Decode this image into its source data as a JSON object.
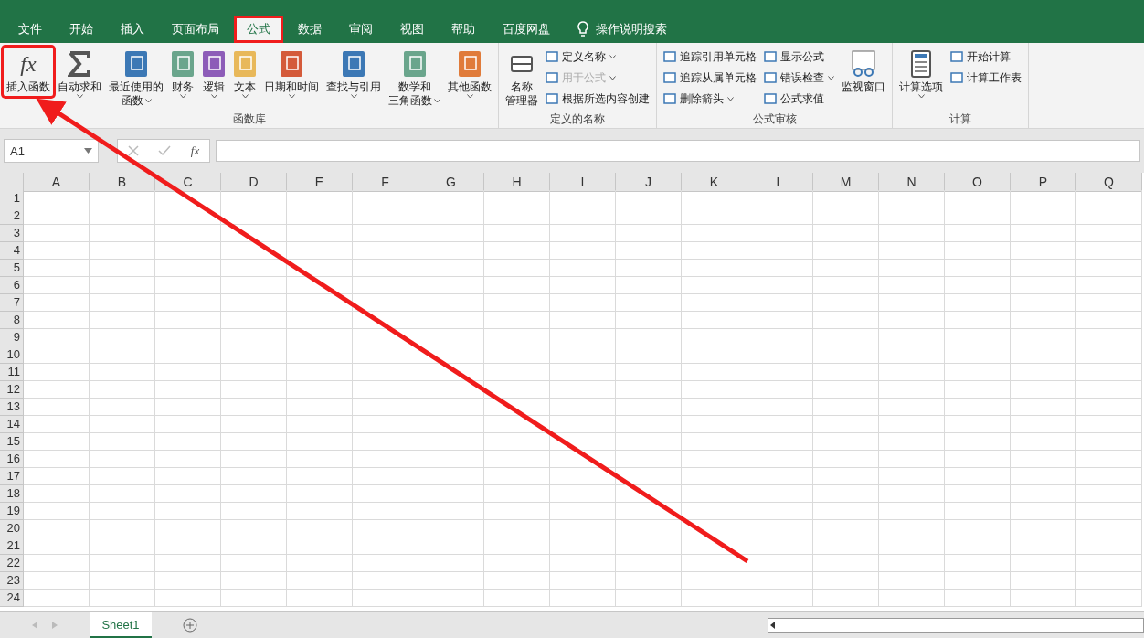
{
  "tabs": [
    {
      "label": "文件",
      "selected": false,
      "highlighted": false
    },
    {
      "label": "开始",
      "selected": false,
      "highlighted": false
    },
    {
      "label": "插入",
      "selected": false,
      "highlighted": false
    },
    {
      "label": "页面布局",
      "selected": false,
      "highlighted": false
    },
    {
      "label": "公式",
      "selected": true,
      "highlighted": true
    },
    {
      "label": "数据",
      "selected": false,
      "highlighted": false
    },
    {
      "label": "审阅",
      "selected": false,
      "highlighted": false
    },
    {
      "label": "视图",
      "selected": false,
      "highlighted": false
    },
    {
      "label": "帮助",
      "selected": false,
      "highlighted": false
    },
    {
      "label": "百度网盘",
      "selected": false,
      "highlighted": false
    }
  ],
  "tell_me": "操作说明搜索",
  "ribbon": [
    {
      "label": "函数库",
      "items": [
        {
          "kind": "fx",
          "symbol": "fx",
          "lines": [
            "插入函数"
          ],
          "dropdown": false,
          "highlighted": true
        },
        {
          "kind": "sigma",
          "lines": [
            "自动求和"
          ],
          "dropdown": true,
          "highlighted": false
        },
        {
          "kind": "book",
          "color": "#3c78b5",
          "lines": [
            "最近使用的",
            "函数"
          ],
          "dropdown": true,
          "highlighted": false
        },
        {
          "kind": "book",
          "color": "#6aa58c",
          "lines": [
            "财务"
          ],
          "dropdown": true,
          "highlighted": false
        },
        {
          "kind": "book",
          "color": "#8d5cb8",
          "lines": [
            "逻辑"
          ],
          "dropdown": true,
          "highlighted": false
        },
        {
          "kind": "book",
          "color": "#e8b85a",
          "lines": [
            "文本"
          ],
          "dropdown": true,
          "highlighted": false
        },
        {
          "kind": "book",
          "color": "#d45a3a",
          "lines": [
            "日期和时间"
          ],
          "dropdown": true,
          "highlighted": false
        },
        {
          "kind": "book",
          "color": "#3c78b5",
          "lines": [
            "查找与引用"
          ],
          "dropdown": true,
          "highlighted": false
        },
        {
          "kind": "book",
          "color": "#6aa58c",
          "lines": [
            "数学和",
            "三角函数"
          ],
          "dropdown": true,
          "highlighted": false
        },
        {
          "kind": "book",
          "color": "#e07b3a",
          "lines": [
            "其他函数"
          ],
          "dropdown": true,
          "highlighted": false
        }
      ]
    },
    {
      "label": "定义的名称",
      "items": [
        {
          "kind": "names",
          "lines": [
            "名称",
            "管理器"
          ],
          "dropdown": false,
          "highlighted": false
        },
        {
          "kind": "stack",
          "entries": [
            {
              "label": "定义名称",
              "dropdown": true,
              "disabled": false
            },
            {
              "label": "用于公式",
              "dropdown": true,
              "disabled": true
            },
            {
              "label": "根据所选内容创建",
              "dropdown": false,
              "disabled": false
            }
          ]
        }
      ]
    },
    {
      "label": "公式审核",
      "items": [
        {
          "kind": "stack",
          "entries": [
            {
              "label": "追踪引用单元格",
              "dropdown": false,
              "disabled": false
            },
            {
              "label": "追踪从属单元格",
              "dropdown": false,
              "disabled": false
            },
            {
              "label": "删除箭头",
              "dropdown": true,
              "disabled": false
            }
          ]
        },
        {
          "kind": "stack",
          "entries": [
            {
              "label": "显示公式",
              "dropdown": false,
              "disabled": false
            },
            {
              "label": "错误检查",
              "dropdown": true,
              "disabled": false
            },
            {
              "label": "公式求值",
              "dropdown": false,
              "disabled": false
            }
          ]
        },
        {
          "kind": "watch",
          "lines": [
            "监视窗口"
          ],
          "dropdown": false,
          "highlighted": false
        }
      ]
    },
    {
      "label": "计算",
      "items": [
        {
          "kind": "calc",
          "lines": [
            "计算选项"
          ],
          "dropdown": true,
          "highlighted": false
        },
        {
          "kind": "stack",
          "entries": [
            {
              "label": "开始计算",
              "dropdown": false,
              "disabled": false
            },
            {
              "label": "计算工作表",
              "dropdown": false,
              "disabled": false
            }
          ]
        }
      ]
    }
  ],
  "name_box": "A1",
  "formula_symbol": "fx",
  "columns": [
    "A",
    "B",
    "C",
    "D",
    "E",
    "F",
    "G",
    "H",
    "I",
    "J",
    "K",
    "L",
    "M",
    "N",
    "O",
    "P",
    "Q"
  ],
  "rows": [
    "1",
    "2",
    "3",
    "4",
    "5",
    "6",
    "7",
    "8",
    "9",
    "10",
    "11",
    "12",
    "13",
    "14",
    "15",
    "16",
    "17",
    "18",
    "19",
    "20",
    "21",
    "22",
    "23",
    "24"
  ],
  "sheets": [
    {
      "label": "Sheet1",
      "selected": true
    }
  ]
}
